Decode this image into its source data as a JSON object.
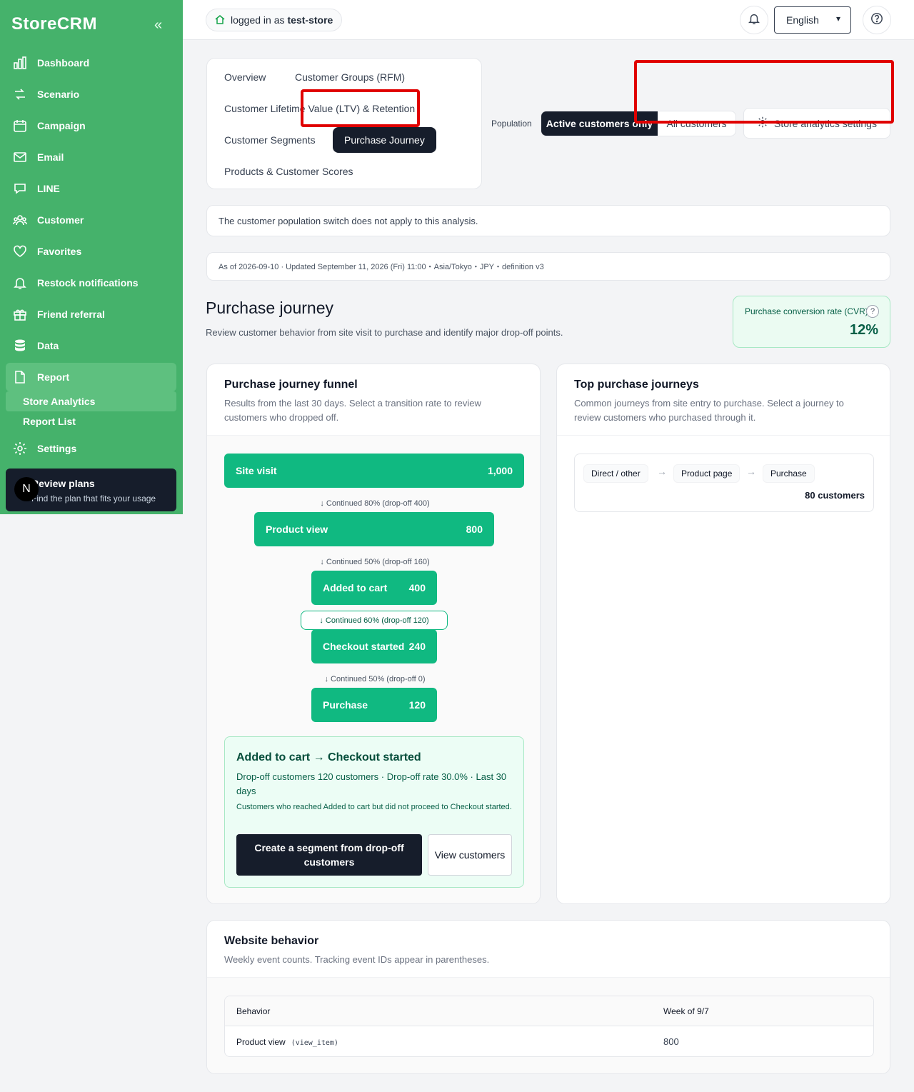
{
  "app": {
    "brand": "StoreCRM"
  },
  "sidebar": {
    "items": [
      {
        "label": "Dashboard",
        "icon": "chart-bar-icon"
      },
      {
        "label": "Scenario",
        "icon": "flow-icon"
      },
      {
        "label": "Campaign",
        "icon": "calendar-icon"
      },
      {
        "label": "Email",
        "icon": "mail-icon"
      },
      {
        "label": "LINE",
        "icon": "chat-icon"
      },
      {
        "label": "Customer",
        "icon": "users-icon"
      },
      {
        "label": "Favorites",
        "icon": "heart-icon"
      },
      {
        "label": "Restock notifications",
        "icon": "bell-icon"
      },
      {
        "label": "Friend referral",
        "icon": "gift-icon"
      },
      {
        "label": "Data",
        "icon": "database-icon"
      },
      {
        "label": "Report",
        "icon": "document-icon"
      }
    ],
    "subitems": [
      {
        "label": "Store Analytics"
      },
      {
        "label": "Report List"
      }
    ],
    "settings": {
      "label": "Settings",
      "icon": "gear-icon"
    },
    "plan": {
      "badge": "N",
      "title": "Review plans",
      "subtitle": "Find the plan that fits your usage"
    }
  },
  "topbar": {
    "login_prefix": "logged in as",
    "store": "test-store",
    "language": "English"
  },
  "tabs": [
    {
      "label": "Overview"
    },
    {
      "label": "Customer Groups (RFM)"
    },
    {
      "label": "Customer Lifetime Value (LTV) & Retention"
    },
    {
      "label": "Customer Segments"
    },
    {
      "label": "Purchase Journey"
    },
    {
      "label": "Products & Customer Scores"
    }
  ],
  "population": {
    "label": "Population",
    "options": [
      "Active customers only",
      "All customers"
    ],
    "selected": "Active customers only",
    "settings_label": "Store analytics settings"
  },
  "notice": "The customer population switch does not apply to this analysis.",
  "asof": "As of 2026-09-10 · Updated September 11, 2026 (Fri) 11:00・Asia/Tokyo・JPY・definition v3",
  "page": {
    "title": "Purchase journey",
    "subtitle": "Review customer behavior from site visit to purchase and identify major drop-off points."
  },
  "cvr": {
    "label": "Purchase conversion rate (CVR)",
    "help": "?",
    "value": "12%"
  },
  "funnel": {
    "title": "Purchase journey funnel",
    "description": "Results from the last 30 days. Select a transition rate to review customers who dropped off.",
    "stages": [
      {
        "label": "Site visit",
        "value": "1,000"
      },
      {
        "label": "Product view",
        "value": "800"
      },
      {
        "label": "Added to cart",
        "value": "400"
      },
      {
        "label": "Checkout started",
        "value": "240"
      },
      {
        "label": "Purchase",
        "value": "120"
      }
    ],
    "transitions": [
      {
        "label": "↓ Continued 80% (drop-off 400)"
      },
      {
        "label": "↓ Continued 50% (drop-off 160)"
      },
      {
        "label": "↓ Continued 60% (drop-off 120)",
        "selected": true
      },
      {
        "label": "↓ Continued 50% (drop-off 0)"
      }
    ],
    "detail": {
      "title": "Added to cart → Checkout started",
      "meta": "Drop-off customers 120 customers · Drop-off rate 30.0% · Last 30 days",
      "note": "Customers who reached Added to cart but did not proceed to Checkout started.",
      "primary_button": "Create a segment from drop-off customers",
      "secondary_button": "View customers"
    }
  },
  "journeys": {
    "title": "Top purchase journeys",
    "description": "Common journeys from site entry to purchase. Select a journey to review customers who purchased through it.",
    "items": [
      {
        "steps": [
          "Direct / other",
          "Product page",
          "Purchase"
        ],
        "count": "80 customers"
      }
    ]
  },
  "website": {
    "title": "Website behavior",
    "description": "Weekly event counts. Tracking event IDs appear in parentheses.",
    "columns": [
      "Behavior",
      "Week of 9/7"
    ],
    "rows": [
      {
        "behavior": "Product view",
        "event_id": "(view_item)",
        "value": "800"
      }
    ]
  }
}
